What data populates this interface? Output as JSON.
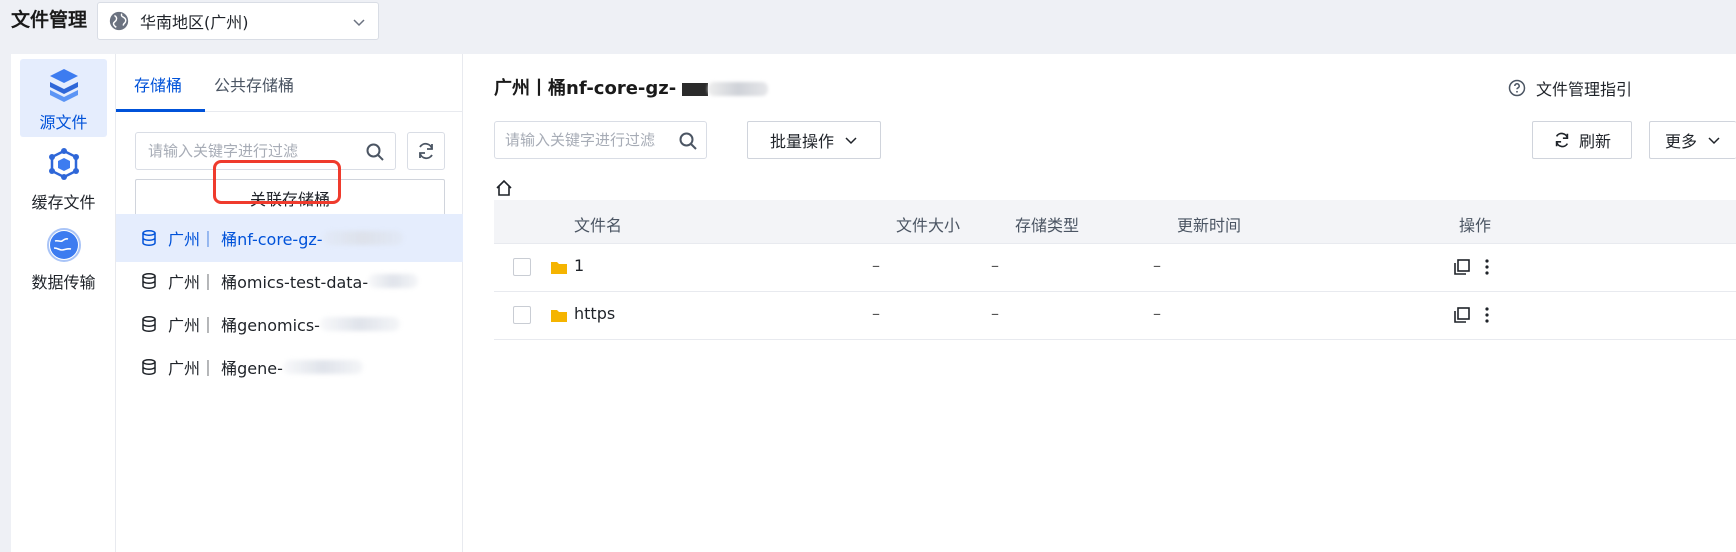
{
  "header": {
    "title": "文件管理",
    "region": "华南地区(广州)"
  },
  "rail": {
    "items": [
      {
        "label": "源文件",
        "icon": "source-files-icon",
        "active": true
      },
      {
        "label": "缓存文件",
        "icon": "cache-files-icon",
        "active": false
      },
      {
        "label": "数据传输",
        "icon": "data-transfer-icon",
        "active": false
      }
    ]
  },
  "bucket_panel": {
    "tabs": [
      "存储桶",
      "公共存储桶"
    ],
    "filter_placeholder": "请输入关键字进行过滤",
    "associate_button": "关联存储桶",
    "buckets": [
      {
        "label": "广州｜ 桶nf-core-gz-",
        "active": true
      },
      {
        "label": "广州｜ 桶omics-test-data-",
        "active": false
      },
      {
        "label": "广州｜ 桶genomics-",
        "active": false
      },
      {
        "label": "广州｜ 桶gene-",
        "active": false
      }
    ]
  },
  "content": {
    "title": "广州丨桶nf-core-gz-",
    "guide_label": "文件管理指引",
    "filter_placeholder": "请输入关键字进行过滤",
    "batch_button": "批量操作",
    "refresh_button": "刷新",
    "more_button": "更多",
    "table": {
      "columns": [
        "文件名",
        "文件大小",
        "存储类型",
        "更新时间",
        "操作"
      ],
      "rows": [
        {
          "name": "1",
          "size": "–",
          "storage": "–",
          "updated": "–"
        },
        {
          "name": "https",
          "size": "–",
          "storage": "–",
          "updated": "–"
        }
      ]
    }
  },
  "colors": {
    "accent": "#0052d9",
    "active_bg": "#e5edfd",
    "highlight": "#ef3b2d",
    "folder": "#f5b400"
  }
}
